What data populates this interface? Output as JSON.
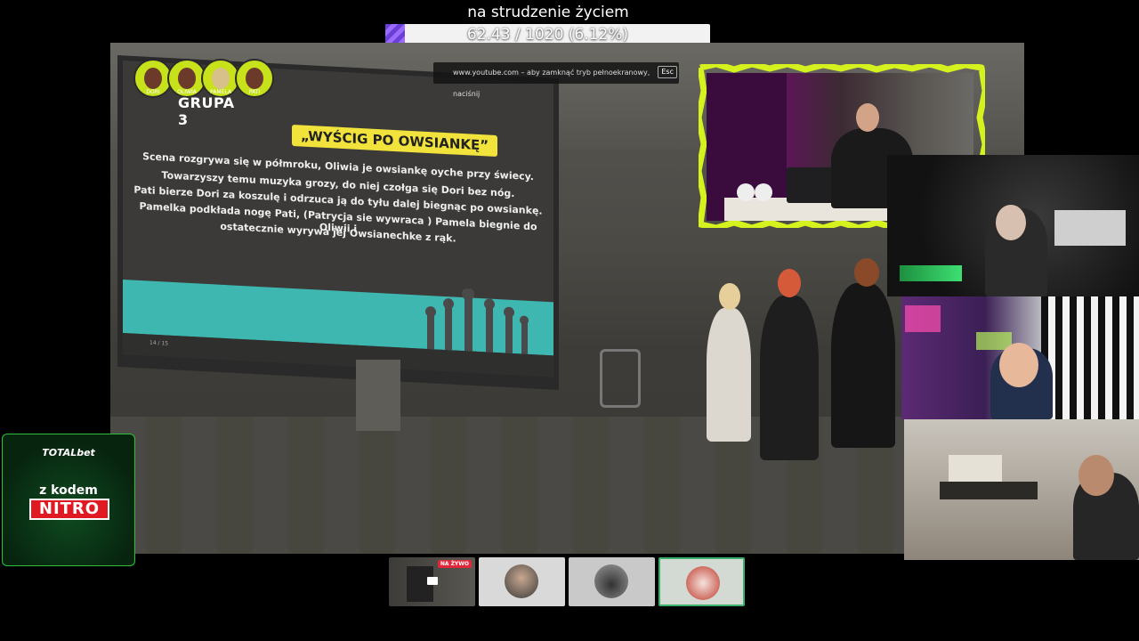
{
  "goal": {
    "title": "na strudzenie życiem",
    "progress_text": "62.43 / 1020 (6.12%)",
    "progress_fraction": 0.0612,
    "fill_color": "#7a4fe6"
  },
  "stream": {
    "group_label": "GRUPA 3",
    "members": [
      "DORI",
      "OLIWIA",
      "PAMELA",
      "PATI"
    ],
    "fullscreen_notice": "www.youtube.com – aby zamknąć tryb pełnoekranowy, naciśnij",
    "esc_key": "Esc",
    "slide": {
      "title": "„WYŚCIG PO OWSIANKĘ”",
      "lines": [
        "Scena rozgrywa się w półmroku, Oliwia  je owsiankę oyche przy świecy.",
        "Towarzyszy temu muzyka grozy, do niej czołga się Dori bez nóg.",
        "Pati bierze Dori za koszulę i odrzuca ją do tyłu dalej biegnąc po owsiankę.",
        "Pamelka podkłada nogę Pati, (Patrycja sie wywraca ) Pamela biegnie do Oliwii i",
        "ostatecznie wyrywa jej Owsianechke z rąk."
      ],
      "page_indicator": "14 / 15"
    }
  },
  "sponsor": {
    "brand": "TOTALbet",
    "code_prefix": "z kodem",
    "code": "NITRO",
    "accent": "#2fbf3c"
  },
  "thumbnails": [
    {
      "name": "scene",
      "badge": "NA ŻYWO"
    },
    {
      "name": "person-avatar"
    },
    {
      "name": "car-avatar"
    },
    {
      "name": "pink-avatar"
    }
  ],
  "colors": {
    "frame_lime": "#d5f11e",
    "slide_teal": "#3fb7b1",
    "badge_yellow": "#f1e33b"
  }
}
